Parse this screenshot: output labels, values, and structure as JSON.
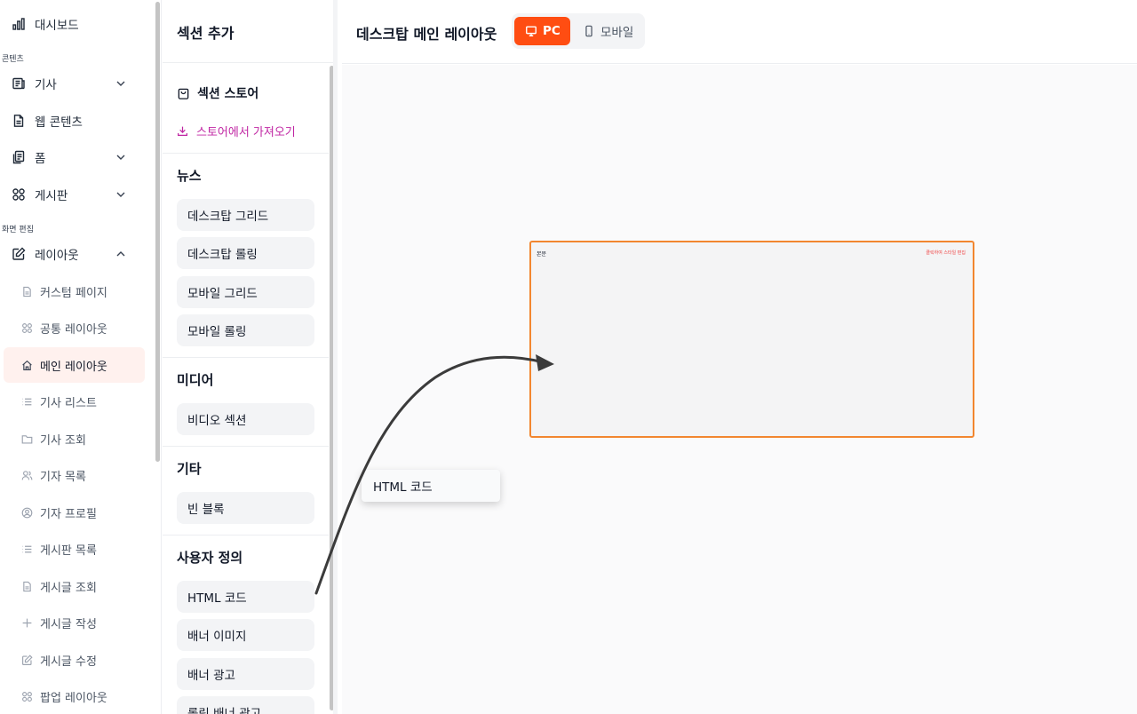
{
  "nav": {
    "dashboard": "대시보드",
    "group_content": "콘텐츠",
    "article": "기사",
    "web_content": "웹 콘텐츠",
    "form": "폼",
    "board": "게시판",
    "group_screen": "화면 편집",
    "layout": "레이아웃",
    "layout_sub": [
      {
        "label": "커스텀 페이지",
        "icon": "file-icon"
      },
      {
        "label": "공통 레이아웃",
        "icon": "grid-icon"
      },
      {
        "label": "메인 레이아웃",
        "icon": "home-icon",
        "active": true
      },
      {
        "label": "기사 리스트",
        "icon": "list-icon"
      },
      {
        "label": "기사 조회",
        "icon": "folder-icon"
      },
      {
        "label": "기자 목록",
        "icon": "users-icon"
      },
      {
        "label": "기자 프로필",
        "icon": "user-circle-icon"
      },
      {
        "label": "게시판 목록",
        "icon": "list-icon"
      },
      {
        "label": "게시글 조회",
        "icon": "file-icon"
      },
      {
        "label": "게시글 작성",
        "icon": "plus-icon"
      },
      {
        "label": "게시글 수정",
        "icon": "edit-icon"
      },
      {
        "label": "팝업 레이아웃",
        "icon": "grid-icon"
      }
    ]
  },
  "panel": {
    "title": "섹션 추가",
    "store_title": "섹션 스토어",
    "store_link": "스토어에서 가져오기",
    "groups": {
      "news": {
        "title": "뉴스",
        "items": [
          "데스크탑 그리드",
          "데스크탑 롤링",
          "모바일 그리드",
          "모바일 롤링"
        ]
      },
      "media": {
        "title": "미디어",
        "items": [
          "비디오 섹션"
        ]
      },
      "etc": {
        "title": "기타",
        "items": [
          "빈 블록"
        ]
      },
      "custom": {
        "title": "사용자 정의",
        "items": [
          "HTML 코드",
          "배너 이미지",
          "배너 광고",
          "롤링 배너 광고"
        ]
      }
    }
  },
  "topbar": {
    "title": "데스크탑 메인 레이아웃",
    "pc_label": "PC",
    "mobile_label": "모바일"
  },
  "canvas": {
    "frame_label": "본문",
    "frame_edit": "클릭하여 스타일 편집",
    "drag_item": "HTML 코드"
  },
  "colors": {
    "accent": "#ff4d12",
    "frame_border": "#f2862f",
    "store_link": "#c026a3",
    "active_bg": "#fff1ee"
  }
}
